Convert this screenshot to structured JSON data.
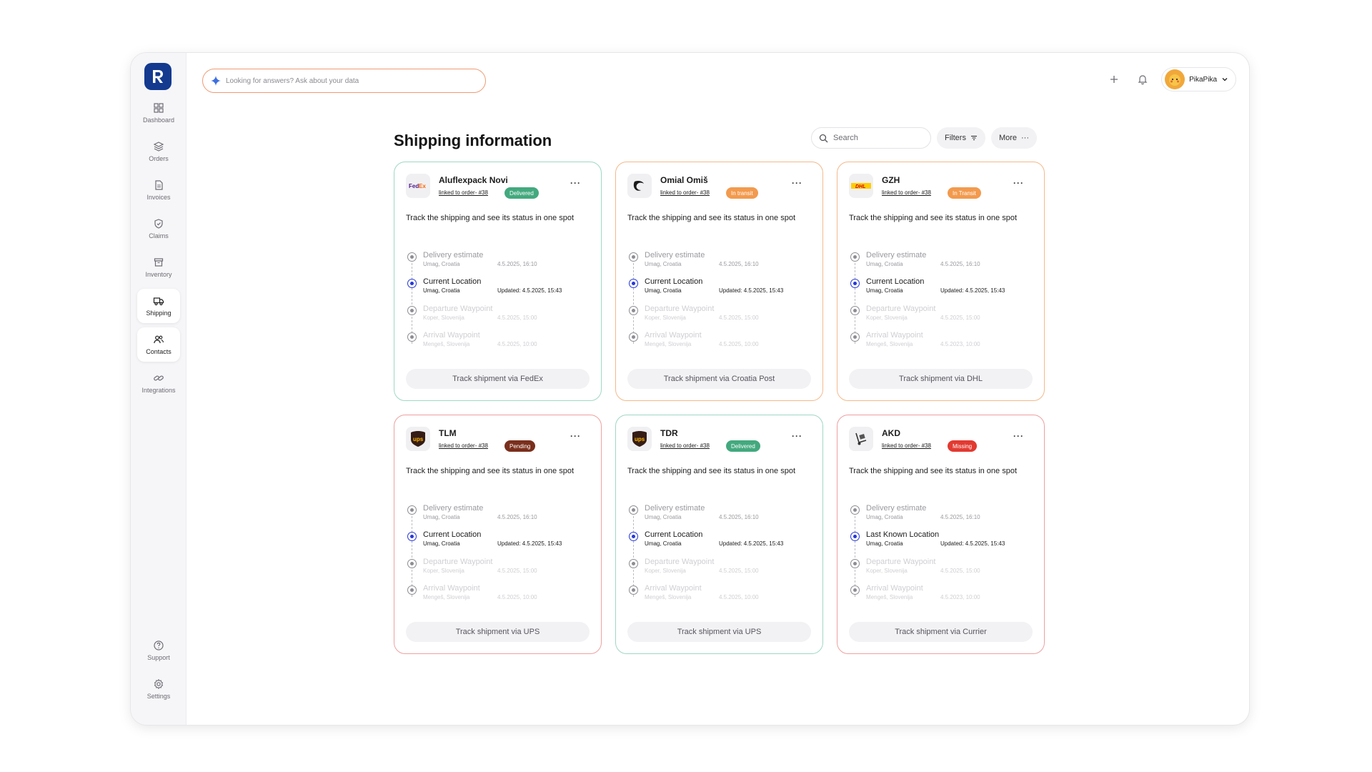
{
  "sidebar": {
    "items": [
      {
        "label": "Dashboard"
      },
      {
        "label": "Orders"
      },
      {
        "label": "Invoices"
      },
      {
        "label": "Claims"
      },
      {
        "label": "Inventory"
      },
      {
        "label": "Shipping"
      },
      {
        "label": "Contacts"
      },
      {
        "label": "Integrations"
      }
    ],
    "bottom": [
      {
        "label": "Support"
      },
      {
        "label": "Settings"
      }
    ]
  },
  "header": {
    "ask_placeholder": "Looking for answers? Ask about your data",
    "user_name": "PikaPika"
  },
  "page": {
    "title": "Shipping information",
    "search_placeholder": "Search",
    "filters_label": "Filters",
    "more_label": "More"
  },
  "cards": [
    {
      "name": "Aluflexpack Novi",
      "link": "linked to order- #38",
      "status": "Delivered",
      "logo_text": "FedEx",
      "description": "Track the shipping and see its status in one spot",
      "steps": [
        {
          "title": "Delivery estimate",
          "location": "Umag, Croatia",
          "time": "4.5.2025, 16:10"
        },
        {
          "title": "Current Location",
          "location": "Umag, Croatia",
          "time": "Updated: 4.5.2025, 15:43"
        },
        {
          "title": "Departure Waypoint",
          "location": "Koper, Slovenija",
          "time": "4.5.2025, 15:00"
        },
        {
          "title": "Arrival Waypoint",
          "location": "Mengeš, Slovenija",
          "time": "4.5.2025, 10:00"
        }
      ],
      "track_label": "Track shipment via FedEx"
    },
    {
      "name": "Omial Omiš",
      "link": "linked to order- #38",
      "status": "In transit",
      "logo_text": "",
      "description": "Track the shipping and see its status in one spot",
      "steps": [
        {
          "title": "Delivery estimate",
          "location": "Umag, Croatia",
          "time": "4.5.2025, 16:10"
        },
        {
          "title": "Current Location",
          "location": "Umag, Croatia",
          "time": "Updated: 4.5.2025, 15:43"
        },
        {
          "title": "Departure Waypoint",
          "location": "Koper, Slovenija",
          "time": "4.5.2025, 15:00"
        },
        {
          "title": "Arrival Waypoint",
          "location": "Mengeš, Slovenija",
          "time": "4.5.2025, 10:00"
        }
      ],
      "track_label": "Track shipment via Croatia Post"
    },
    {
      "name": "GZH",
      "link": "linked to order- #38",
      "status": "In Transit",
      "logo_text": "DHL",
      "description": "Track the shipping and see its status in one spot",
      "steps": [
        {
          "title": "Delivery estimate",
          "location": "Umag, Croatia",
          "time": "4.5.2025, 16:10"
        },
        {
          "title": "Current Location",
          "location": "Umag, Croatia",
          "time": "Updated: 4.5.2025, 15:43"
        },
        {
          "title": "Departure Waypoint",
          "location": "Koper, Slovenija",
          "time": "4.5.2025, 15:00"
        },
        {
          "title": "Arrival Waypoint",
          "location": "Mengeš, Slovenija",
          "time": "4.5.2023, 10:00"
        }
      ],
      "track_label": "Track shipment via DHL"
    },
    {
      "name": "TLM",
      "link": "linked to order- #38",
      "status": "Pending",
      "logo_text": "ups",
      "description": "Track the shipping and see its status in one spot",
      "steps": [
        {
          "title": "Delivery estimate",
          "location": "Umag, Croatia",
          "time": "4.5.2025, 16:10"
        },
        {
          "title": "Current Location",
          "location": "Umag, Croatia",
          "time": "Updated: 4.5.2025, 15:43"
        },
        {
          "title": "Departure Waypoint",
          "location": "Koper, Slovenija",
          "time": "4.5.2025, 15:00"
        },
        {
          "title": "Arrival Waypoint",
          "location": "Mengeš, Slovenija",
          "time": "4.5.2025, 10:00"
        }
      ],
      "track_label": "Track shipment via UPS"
    },
    {
      "name": "TDR",
      "link": "linked to order- #38",
      "status": "Delivered",
      "logo_text": "ups",
      "description": "Track the shipping and see its status in one spot",
      "steps": [
        {
          "title": "Delivery estimate",
          "location": "Umag, Croatia",
          "time": "4.5.2025, 16:10"
        },
        {
          "title": "Current Location",
          "location": "Umag, Croatia",
          "time": "Updated: 4.5.2025, 15:43"
        },
        {
          "title": "Departure Waypoint",
          "location": "Koper, Slovenija",
          "time": "4.5.2025, 15:00"
        },
        {
          "title": "Arrival Waypoint",
          "location": "Mengeš, Slovenija",
          "time": "4.5.2025, 10:00"
        }
      ],
      "track_label": "Track shipment via UPS"
    },
    {
      "name": "AKD",
      "link": "linked to order- #38",
      "status": "Missing",
      "logo_text": "",
      "description": "Track the shipping and see its status in one spot",
      "steps": [
        {
          "title": "Delivery estimate",
          "location": "Umag, Croatia",
          "time": "4.5.2025, 16:10"
        },
        {
          "title": "Last Known Location",
          "location": "Umag, Croatia",
          "time": "Updated: 4.5.2025, 15:43"
        },
        {
          "title": "Departure Waypoint",
          "location": "Koper, Slovenija",
          "time": "4.5.2025, 15:00"
        },
        {
          "title": "Arrival Waypoint",
          "location": "Mengeš, Slovenija",
          "time": "4.5.2023, 10:00"
        }
      ],
      "track_label": "Track shipment via Currier"
    }
  ],
  "colors": {
    "brand": "#133a8f",
    "delivered": "#43a97e",
    "in_transit": "#f29a4e",
    "pending": "#7a2f1d",
    "missing": "#e23a31",
    "current_step": "#2637d8"
  }
}
